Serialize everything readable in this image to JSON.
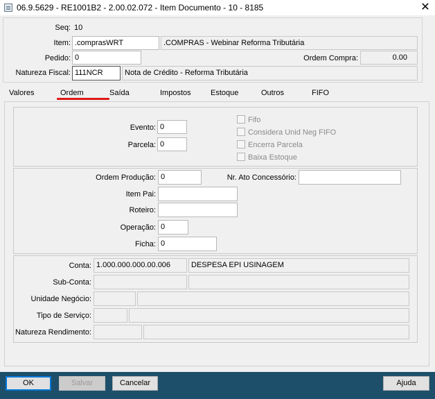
{
  "window": {
    "title": "06.9.5629 - RE1001B2 - 2.00.02.072 - Item Documento - 10 - 8185",
    "close_glyph": "✕"
  },
  "header": {
    "seq_label": "Seq:",
    "seq_value": "10",
    "item_label": "Item:",
    "item_code": ".comprasWRT",
    "item_desc": ".COMPRAS - Webinar Reforma Tributária",
    "pedido_label": "Pedido:",
    "pedido_value": "0",
    "ordem_compra_label": "Ordem Compra:",
    "ordem_compra_value": "0.00",
    "natureza_label": "Natureza Fiscal:",
    "natureza_code": "111NCR",
    "natureza_desc": "Nota de Crédito - Reforma Tributária"
  },
  "tabs": [
    {
      "label": "Valores"
    },
    {
      "label": "Ordem"
    },
    {
      "label": "Saída"
    },
    {
      "label": "Impostos"
    },
    {
      "label": "Estoque"
    },
    {
      "label": "Outros"
    },
    {
      "label": "FIFO"
    }
  ],
  "ordem_tab": {
    "evento_label": "Evento:",
    "evento_value": "0",
    "parcela_label": "Parcela:",
    "parcela_value": "0",
    "checkboxes": [
      {
        "label": "Fifo"
      },
      {
        "label": "Considera Unid Neg FIFO"
      },
      {
        "label": "Encerra Parcela"
      },
      {
        "label": "Baixa Estoque"
      }
    ],
    "ordem_producao_label": "Ordem Produção:",
    "ordem_producao_value": "0",
    "nr_ato_label": "Nr. Ato Concessório:",
    "nr_ato_value": "",
    "item_pai_label": "Item Pai:",
    "item_pai_value": "",
    "roteiro_label": "Roteiro:",
    "roteiro_value": "",
    "operacao_label": "Operação:",
    "operacao_value": "0",
    "ficha_label": "Ficha:",
    "ficha_value": "0",
    "conta_label": "Conta:",
    "conta_value": "1.000.000.000.00.006",
    "conta_desc": "DESPESA EPI USINAGEM",
    "subconta_label": "Sub-Conta:",
    "subconta_value": "",
    "subconta_desc": "",
    "unidade_label": "Unidade Negócio:",
    "unidade_value": "",
    "unidade_desc": "",
    "tipo_servico_label": "Tipo de Serviço:",
    "tipo_servico_value": "",
    "tipo_servico_desc": "",
    "natureza_rend_label": "Natureza Rendimento:",
    "natureza_rend_value": "",
    "natureza_rend_desc": ""
  },
  "footer": {
    "ok": "OK",
    "salvar": "Salvar",
    "cancelar": "Cancelar",
    "ajuda": "Ajuda"
  }
}
